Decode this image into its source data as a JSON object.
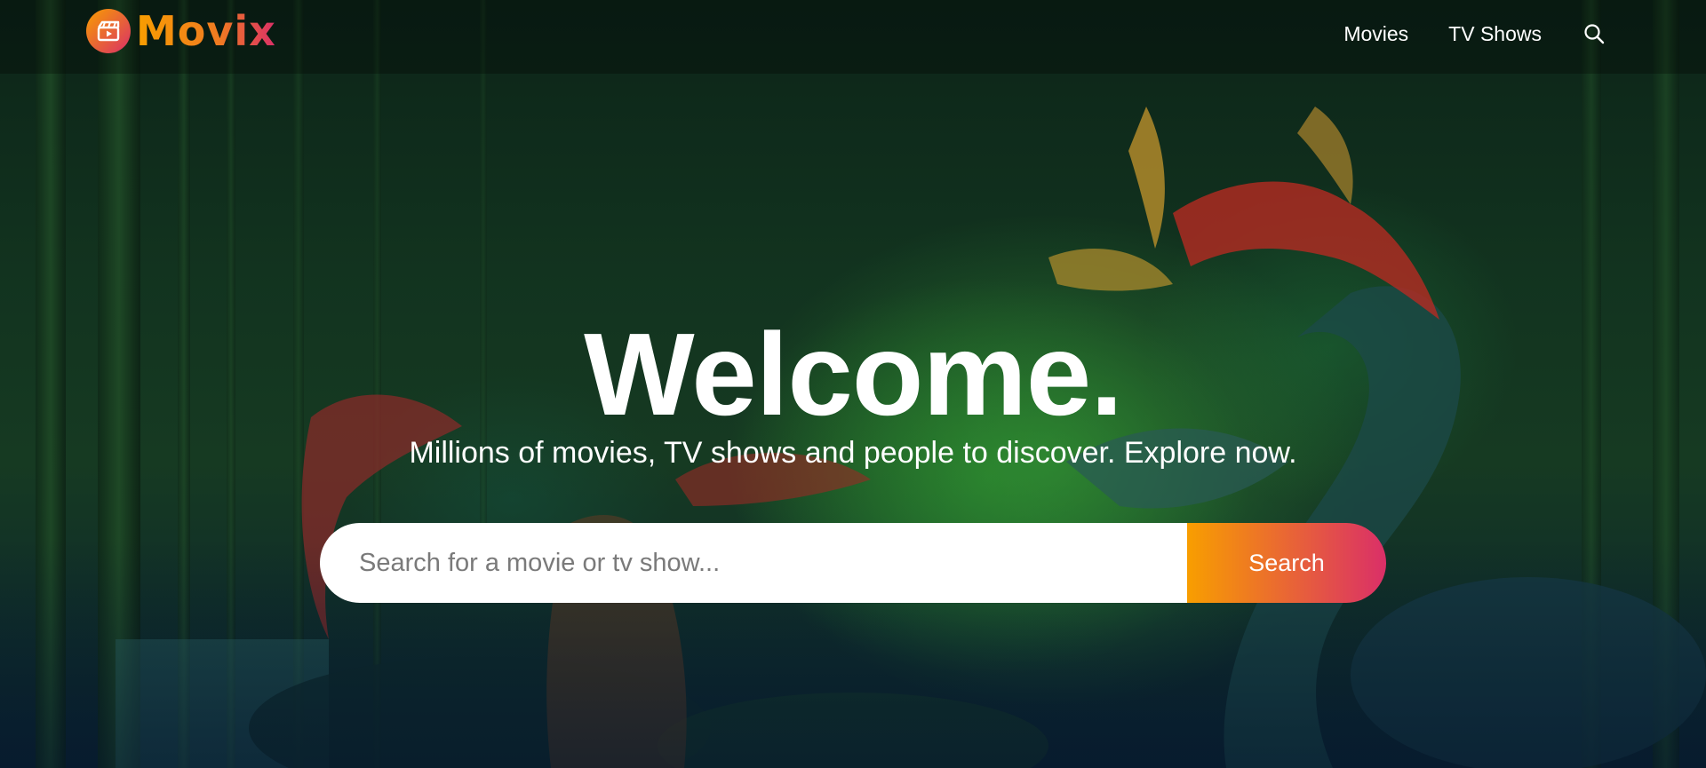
{
  "header": {
    "logo_text": "Movix",
    "nav": [
      {
        "label": "Movies"
      },
      {
        "label": "TV Shows"
      }
    ]
  },
  "hero": {
    "title": "Welcome.",
    "subtitle": "Millions of movies, TV shows and people to discover. Explore now.",
    "search": {
      "placeholder": "Search for a movie or tv show...",
      "value": "",
      "button_label": "Search"
    }
  },
  "colors": {
    "background": "#04152d",
    "accent_start": "#f89e00",
    "accent_end": "#da2f68",
    "text": "#ffffff"
  },
  "icons": {
    "logo": "clapperboard-play-icon",
    "nav_search": "search-icon"
  }
}
